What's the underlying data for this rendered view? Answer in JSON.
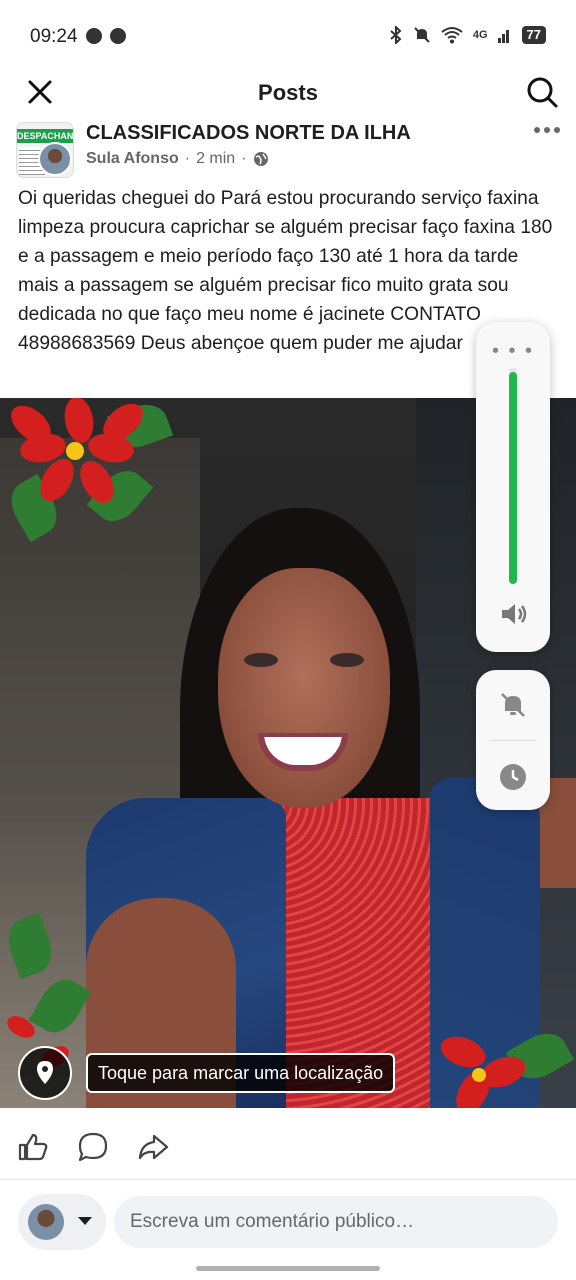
{
  "status_bar": {
    "time": "09:24",
    "network": "4G",
    "battery": "77"
  },
  "header": {
    "title": "Posts"
  },
  "post": {
    "group_name": "CLASSIFICADOS NORTE DA ILHA",
    "group_avatar_text": "DESPACHANTE",
    "author": "Sula Afonso",
    "separator": "·",
    "time": "2 min",
    "separator2": "·",
    "text": "Oi queridas cheguei do Pará estou procurando serviço faxina limpeza proucura caprichar se alguém precisar faço faxina 180 e a passagem e meio período faço 130 até 1 hora da tarde mais a passagem se alguém precisar fico muito grata sou dedicada no que faço meu nome é jacinete CONTATO 48988683569 Deus abençoe quem puder me ajudar",
    "location_prompt": "Toque para marcar uma localização"
  },
  "volume_overlay": {
    "level": 0.98
  },
  "comment": {
    "placeholder": "Escreva um comentário público…"
  },
  "colors": {
    "volume_accent": "#20b84a",
    "text_primary": "#1c1e21",
    "text_secondary": "#65676b"
  },
  "icons": [
    "close-icon",
    "search-icon",
    "more-icon",
    "globe-icon",
    "location-pin-icon",
    "speaker-icon",
    "bell-off-icon",
    "clock-icon",
    "like-icon",
    "comment-icon",
    "share-icon"
  ]
}
